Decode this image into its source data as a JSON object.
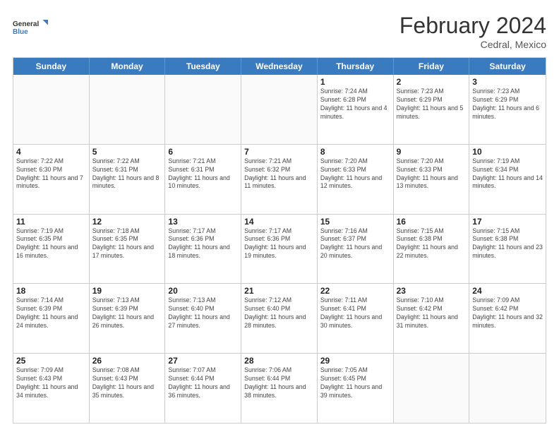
{
  "header": {
    "logo_general": "General",
    "logo_blue": "Blue",
    "month_title": "February 2024",
    "subtitle": "Cedral, Mexico"
  },
  "weekdays": [
    "Sunday",
    "Monday",
    "Tuesday",
    "Wednesday",
    "Thursday",
    "Friday",
    "Saturday"
  ],
  "rows": [
    [
      {
        "day": "",
        "info": ""
      },
      {
        "day": "",
        "info": ""
      },
      {
        "day": "",
        "info": ""
      },
      {
        "day": "",
        "info": ""
      },
      {
        "day": "1",
        "info": "Sunrise: 7:24 AM\nSunset: 6:28 PM\nDaylight: 11 hours and 4 minutes."
      },
      {
        "day": "2",
        "info": "Sunrise: 7:23 AM\nSunset: 6:29 PM\nDaylight: 11 hours and 5 minutes."
      },
      {
        "day": "3",
        "info": "Sunrise: 7:23 AM\nSunset: 6:29 PM\nDaylight: 11 hours and 6 minutes."
      }
    ],
    [
      {
        "day": "4",
        "info": "Sunrise: 7:22 AM\nSunset: 6:30 PM\nDaylight: 11 hours and 7 minutes."
      },
      {
        "day": "5",
        "info": "Sunrise: 7:22 AM\nSunset: 6:31 PM\nDaylight: 11 hours and 8 minutes."
      },
      {
        "day": "6",
        "info": "Sunrise: 7:21 AM\nSunset: 6:31 PM\nDaylight: 11 hours and 10 minutes."
      },
      {
        "day": "7",
        "info": "Sunrise: 7:21 AM\nSunset: 6:32 PM\nDaylight: 11 hours and 11 minutes."
      },
      {
        "day": "8",
        "info": "Sunrise: 7:20 AM\nSunset: 6:33 PM\nDaylight: 11 hours and 12 minutes."
      },
      {
        "day": "9",
        "info": "Sunrise: 7:20 AM\nSunset: 6:33 PM\nDaylight: 11 hours and 13 minutes."
      },
      {
        "day": "10",
        "info": "Sunrise: 7:19 AM\nSunset: 6:34 PM\nDaylight: 11 hours and 14 minutes."
      }
    ],
    [
      {
        "day": "11",
        "info": "Sunrise: 7:19 AM\nSunset: 6:35 PM\nDaylight: 11 hours and 16 minutes."
      },
      {
        "day": "12",
        "info": "Sunrise: 7:18 AM\nSunset: 6:35 PM\nDaylight: 11 hours and 17 minutes."
      },
      {
        "day": "13",
        "info": "Sunrise: 7:17 AM\nSunset: 6:36 PM\nDaylight: 11 hours and 18 minutes."
      },
      {
        "day": "14",
        "info": "Sunrise: 7:17 AM\nSunset: 6:36 PM\nDaylight: 11 hours and 19 minutes."
      },
      {
        "day": "15",
        "info": "Sunrise: 7:16 AM\nSunset: 6:37 PM\nDaylight: 11 hours and 20 minutes."
      },
      {
        "day": "16",
        "info": "Sunrise: 7:15 AM\nSunset: 6:38 PM\nDaylight: 11 hours and 22 minutes."
      },
      {
        "day": "17",
        "info": "Sunrise: 7:15 AM\nSunset: 6:38 PM\nDaylight: 11 hours and 23 minutes."
      }
    ],
    [
      {
        "day": "18",
        "info": "Sunrise: 7:14 AM\nSunset: 6:39 PM\nDaylight: 11 hours and 24 minutes."
      },
      {
        "day": "19",
        "info": "Sunrise: 7:13 AM\nSunset: 6:39 PM\nDaylight: 11 hours and 26 minutes."
      },
      {
        "day": "20",
        "info": "Sunrise: 7:13 AM\nSunset: 6:40 PM\nDaylight: 11 hours and 27 minutes."
      },
      {
        "day": "21",
        "info": "Sunrise: 7:12 AM\nSunset: 6:40 PM\nDaylight: 11 hours and 28 minutes."
      },
      {
        "day": "22",
        "info": "Sunrise: 7:11 AM\nSunset: 6:41 PM\nDaylight: 11 hours and 30 minutes."
      },
      {
        "day": "23",
        "info": "Sunrise: 7:10 AM\nSunset: 6:42 PM\nDaylight: 11 hours and 31 minutes."
      },
      {
        "day": "24",
        "info": "Sunrise: 7:09 AM\nSunset: 6:42 PM\nDaylight: 11 hours and 32 minutes."
      }
    ],
    [
      {
        "day": "25",
        "info": "Sunrise: 7:09 AM\nSunset: 6:43 PM\nDaylight: 11 hours and 34 minutes."
      },
      {
        "day": "26",
        "info": "Sunrise: 7:08 AM\nSunset: 6:43 PM\nDaylight: 11 hours and 35 minutes."
      },
      {
        "day": "27",
        "info": "Sunrise: 7:07 AM\nSunset: 6:44 PM\nDaylight: 11 hours and 36 minutes."
      },
      {
        "day": "28",
        "info": "Sunrise: 7:06 AM\nSunset: 6:44 PM\nDaylight: 11 hours and 38 minutes."
      },
      {
        "day": "29",
        "info": "Sunrise: 7:05 AM\nSunset: 6:45 PM\nDaylight: 11 hours and 39 minutes."
      },
      {
        "day": "",
        "info": ""
      },
      {
        "day": "",
        "info": ""
      }
    ]
  ]
}
